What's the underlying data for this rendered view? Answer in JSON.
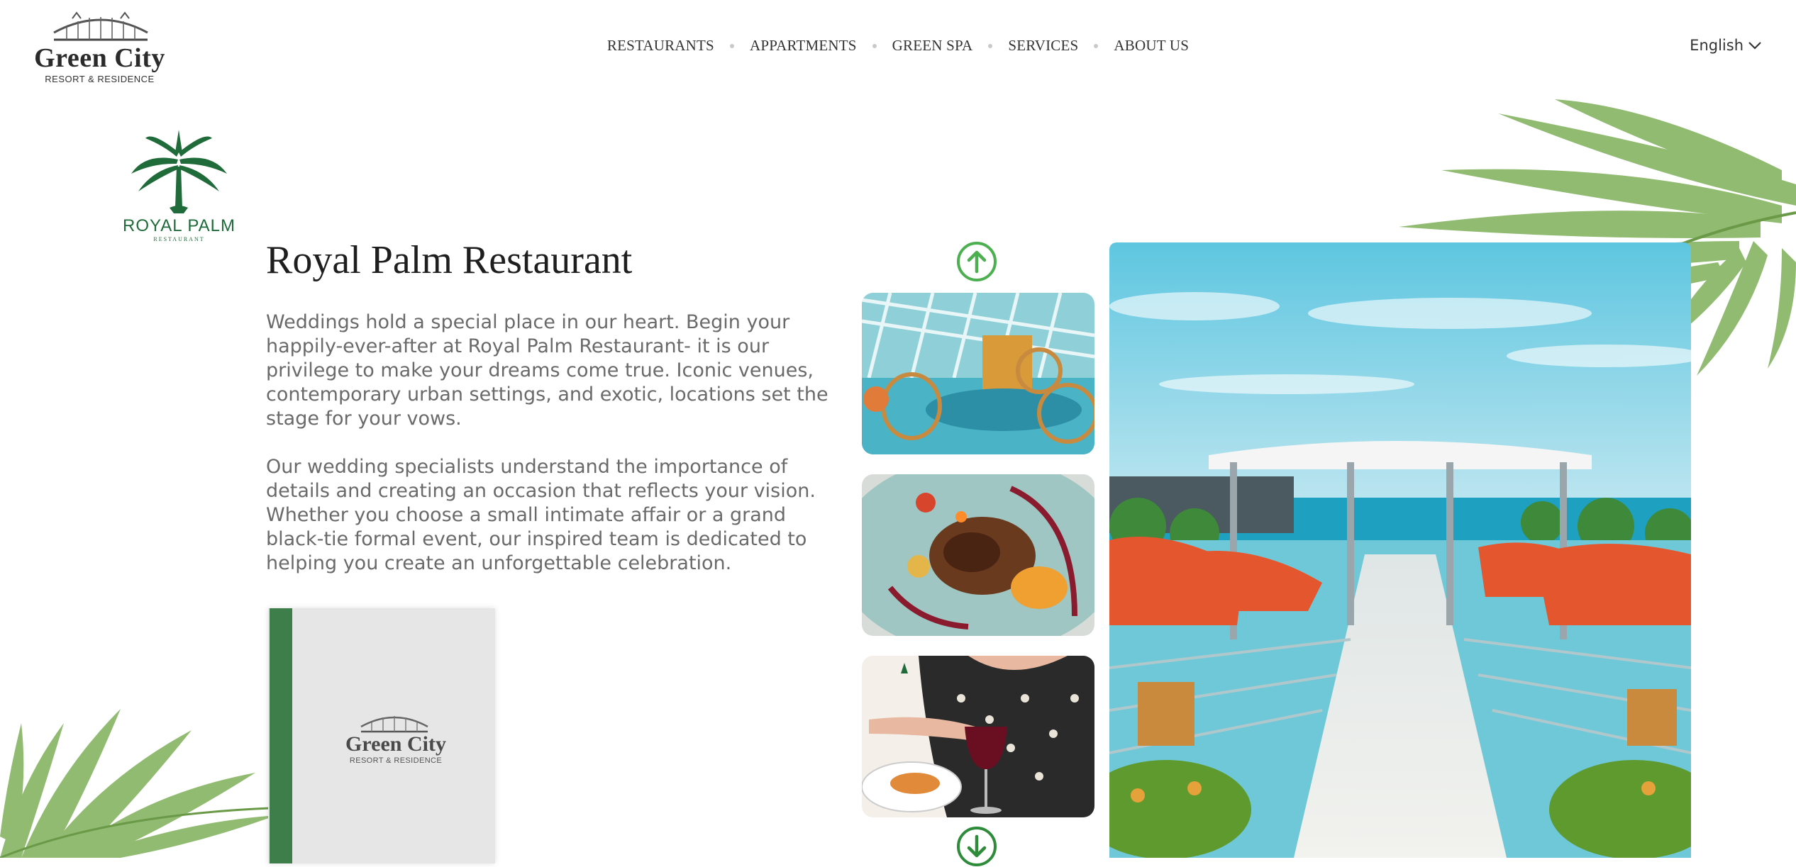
{
  "brand": {
    "name": "Green City",
    "subtitle": "RESORT & RESIDENCE"
  },
  "nav": {
    "items": [
      {
        "label": "RESTAURANTS"
      },
      {
        "label": "APPARTMENTS"
      },
      {
        "label": "GREEN SPA"
      },
      {
        "label": "SERVICES"
      },
      {
        "label": "ABOUT US"
      }
    ]
  },
  "language": {
    "label": "English",
    "icon": "chevron-down-icon"
  },
  "restaurant_logo": {
    "name": "ROYAL PALM",
    "sub": "RESTAURANT"
  },
  "content": {
    "title": "Royal Palm Restaurant",
    "paragraph1": "Weddings hold a special place in our heart. Begin your happily-ever-after at Royal Palm Restaurant- it is our privilege to make your dreams come true. Iconic venues, contemporary urban settings, and exotic, locations set the stage for your vows.",
    "paragraph2": "Our wedding specialists understand the importance of details and creating an occasion that reflects your vision. Whether you choose a small intimate affair or a grand black-tie formal event, our inspired team is dedicated to helping you create an unforgettable celebration."
  },
  "menu_book": {
    "name": "Green City",
    "subtitle": "RESORT & RESIDENCE"
  },
  "gallery": {
    "up_icon": "arrow-up-circle-icon",
    "down_icon": "arrow-down-circle-icon"
  },
  "colors": {
    "accent_green": "#4caf50",
    "brand_green": "#3e7e4b",
    "logo_green": "#1f6b3a"
  }
}
